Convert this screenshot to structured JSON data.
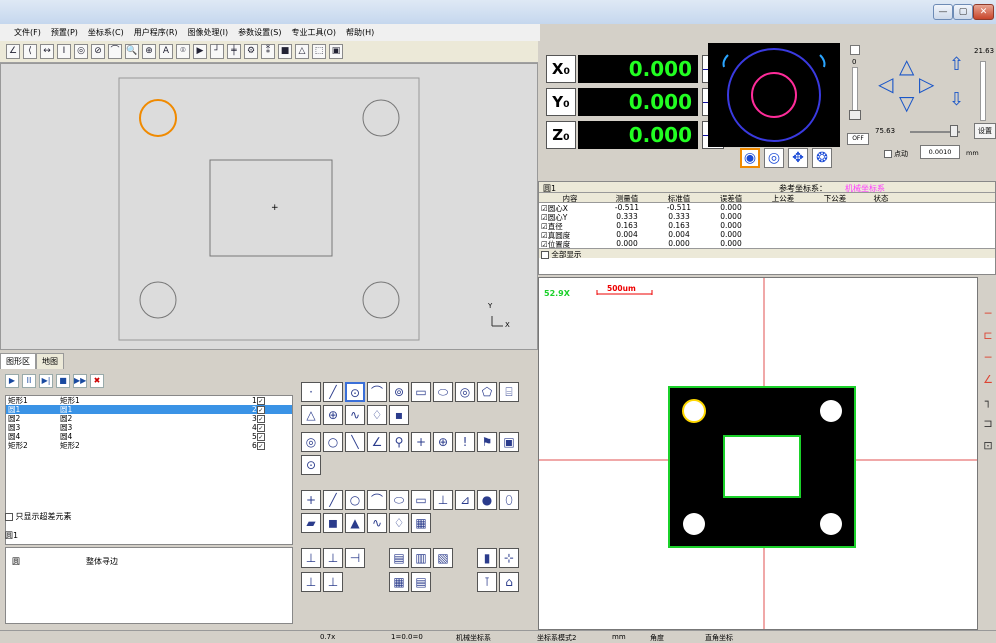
{
  "menu": [
    "文件(F)",
    "预置(P)",
    "坐标系(C)",
    "用户程序(R)",
    "图像处理(I)",
    "参数设置(S)",
    "专业工具(O)",
    "帮助(H)"
  ],
  "window_controls": [
    "—",
    "▢",
    "✕"
  ],
  "toolbar1": [
    "∠",
    "⟨",
    "↔",
    "I",
    "◎",
    "⊘",
    "⌒",
    "🔍",
    "⊕",
    "A",
    "⌾",
    "▶",
    "┘",
    "╪",
    "⚙",
    "⁑",
    "■",
    "△",
    "⬚",
    "▣"
  ],
  "workspace": {
    "axis_y": "Y",
    "axis_x": "X"
  },
  "tabs": [
    "图形区",
    "地图"
  ],
  "controls": [
    "▶",
    "II",
    "▶|",
    "■",
    "▶▶",
    "✖"
  ],
  "elements": [
    {
      "name": "矩形1",
      "label": "矩形1",
      "num": "1",
      "sel": false
    },
    {
      "name": "圆1",
      "label": "圆1",
      "num": "2",
      "sel": true
    },
    {
      "name": "圆2",
      "label": "圆2",
      "num": "3",
      "sel": false
    },
    {
      "name": "圆3",
      "label": "圆3",
      "num": "4",
      "sel": false
    },
    {
      "name": "圆4",
      "label": "圆4",
      "num": "5",
      "sel": false
    },
    {
      "name": "矩形2",
      "label": "矩形2",
      "num": "6",
      "sel": false
    }
  ],
  "only_show": "只显示超差元素",
  "prop": {
    "title": "圆1",
    "key": "圆",
    "value": "整体寻边"
  },
  "dro": {
    "x_label": "X₀",
    "x_val": "0.000",
    "x_frac_top": "X",
    "x_frac_bot": "2",
    "y_label": "Y₀",
    "y_val": "0.000",
    "y_frac_top": "Y",
    "y_frac_bot": "2",
    "z_label": "Z₀",
    "z_val": "0.000",
    "z_frac_top": "Z",
    "z_frac_bot": "2",
    "light_val": "0",
    "off": "OFF"
  },
  "jog": {
    "top_val": "21.63",
    "speed": "75.63",
    "set": "设置",
    "point_label": "点动",
    "step": "0.0010",
    "unit": "mm"
  },
  "meas": {
    "title": "圆1",
    "coord_label": "参考坐标系：",
    "coord_value": "机械坐标系",
    "headers": [
      "内容",
      "测量值",
      "标准值",
      "误差值",
      "上公差",
      "下公差",
      "状态"
    ],
    "rows": [
      [
        "☑圆心X",
        "-0.511",
        "-0.511",
        "0.000"
      ],
      [
        "☑圆心Y",
        "0.333",
        "0.333",
        "0.000"
      ],
      [
        "☑直径",
        "0.163",
        "0.163",
        "0.000"
      ],
      [
        "☑真圆度",
        "0.004",
        "0.004",
        "0.000"
      ],
      [
        "☑位置度",
        "0.000",
        "0.000",
        "0.000"
      ]
    ],
    "all_show": "全部显示"
  },
  "cam": {
    "zoom": "52.9X",
    "scale": "500um"
  },
  "status": [
    "0.7x",
    "1=0.0=0",
    "机械坐标系",
    "坐标系模式2",
    "mm",
    "角度",
    "直角坐标"
  ]
}
